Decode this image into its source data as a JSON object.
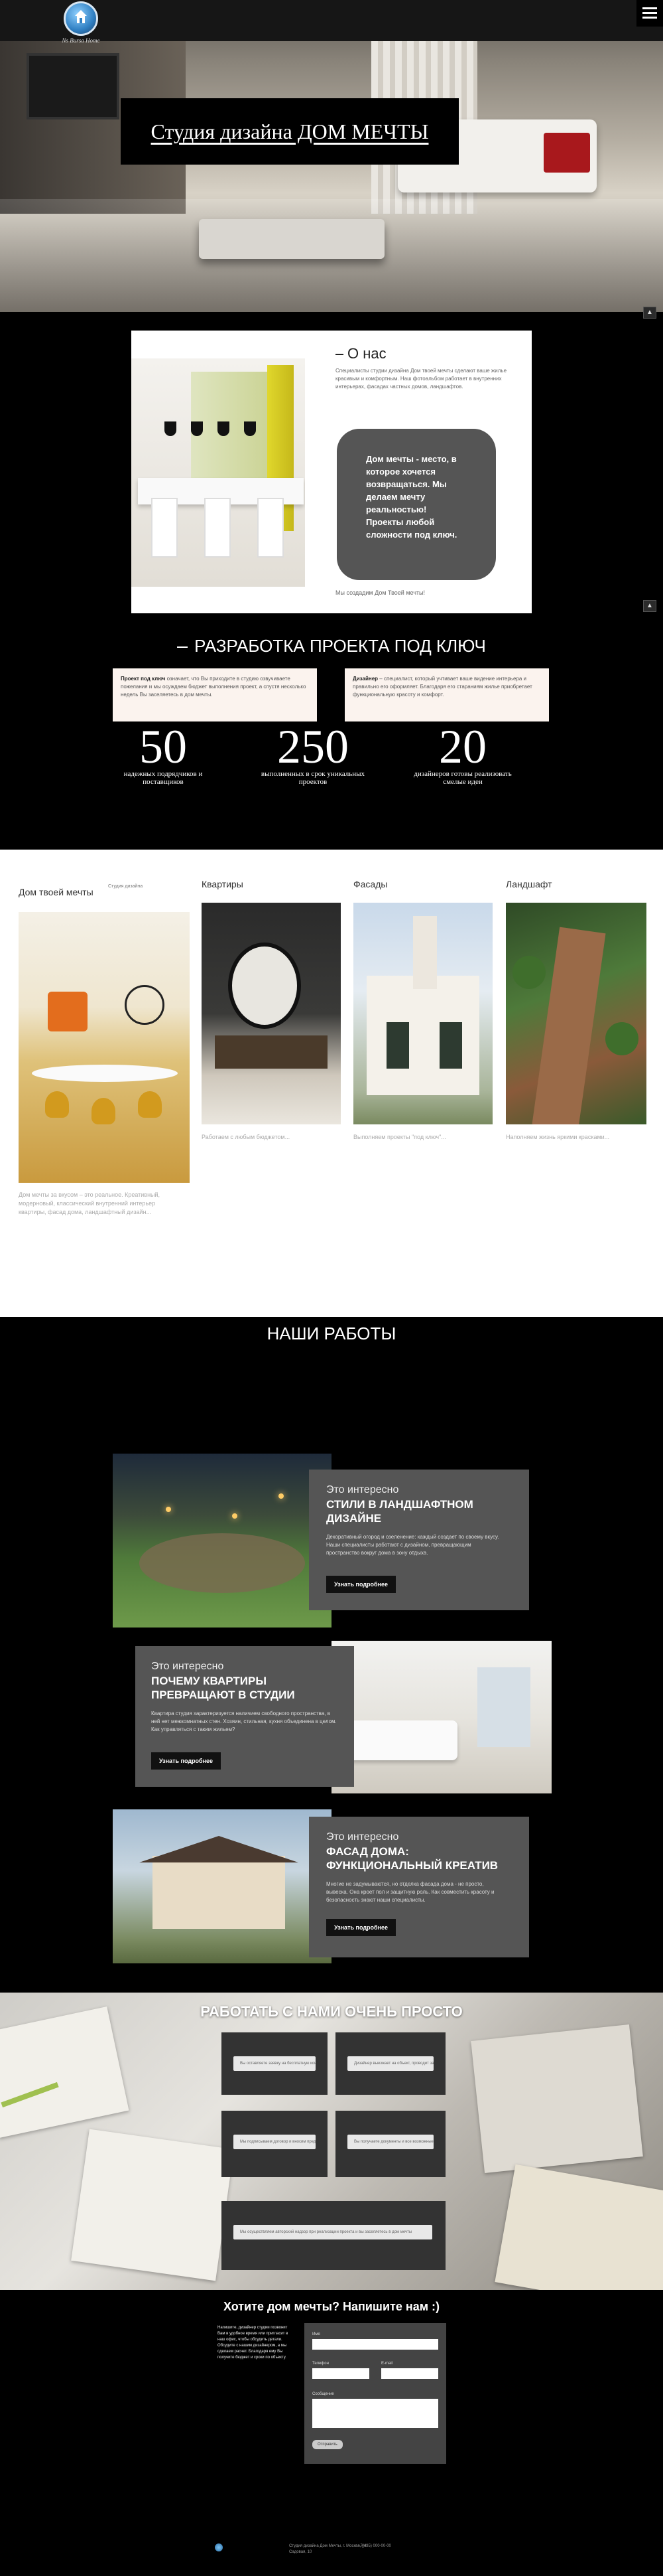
{
  "header": {
    "logo_text": "Ns Bursa Home",
    "menu_icon": "hamburger-icon"
  },
  "hero": {
    "title": "Студия дизайна ДОМ МЕЧТЫ"
  },
  "scroll_top": "▲",
  "about": {
    "title": "О нас",
    "intro": "Специалисты студии дизайна Дом твоей мечты сделают ваше жилье красивым и комфортным. Наш фотоальбом работает в внутренних интерьерах, фасадах частных домов, ландшафтов.",
    "highlight": "Дом мечты - место, в которое хочется возвращаться. Мы делаем мечту реальностью! Проекты любой сложности под ключ.",
    "signature": "Мы создадим Дом Твоей мечты!"
  },
  "turnkey": {
    "title": "РАЗРАБОТКА ПРОЕКТА ПОД КЛЮЧ",
    "box_left_label": "Проект под ключ",
    "box_left_text": "означает, что Вы приходите в студию озвучиваете пожелания и мы осуждаем бюджет выполнения проект, а спустя несколько недель Вы заселяетесь в дом мечты.",
    "box_right_label": "Дизайнер",
    "box_right_text": "– специалист, который учтивает ваше видение интерьера и правильно его оформляет. Благодаря его стараниям жилье приобретает функциональную красоту и комфорт.",
    "stats": [
      {
        "num": "50",
        "label": "надежных подрядчиков и поставщиков"
      },
      {
        "num": "250",
        "label": "выполненных в срок уникальных проектов"
      },
      {
        "num": "20",
        "label": "дизайнеров готовы реализовать смелые идеи"
      }
    ]
  },
  "services": {
    "items": [
      {
        "title": "Дом твоей мечты",
        "small": "Студия дизайна",
        "caption": "Дом мечты за вкусом – это реальное. Креативный, модерновый, классический внутренний интерьер квартиры, фасад дома, ландшафтный дизайн..."
      },
      {
        "title": "Квартиры",
        "caption": "Работаем с любым бюджетом..."
      },
      {
        "title": "Фасады",
        "caption": "Выполняем проекты \"под ключ\"..."
      },
      {
        "title": "Ландшафт",
        "caption": "Наполняем жизнь яркими красками..."
      }
    ]
  },
  "works": {
    "title": "НАШИ РАБОТЫ",
    "cards": [
      {
        "pre": "Это интересно",
        "head": "СТИЛИ В ЛАНДШАФТНОМ ДИЗАЙНЕ",
        "text": "Декоративный огород и озеленение: каждый создает по своему вкусу. Наши специалисты работают с дизайном, превращающим пространство вокруг дома в зону отдыха.",
        "button": "Узнать подробнее"
      },
      {
        "pre": "Это интересно",
        "head": "ПОЧЕМУ КВАРТИРЫ ПРЕВРАЩАЮТ В СТУДИИ",
        "text": "Квартира студия характеризуется наличием свободного пространства, в ней нет межкомнатных стен. Хозяин, стильная, кухня объединена в целом. Как управляться с таким жильем?",
        "button": "Узнать подробнее"
      },
      {
        "pre": "Это интересно",
        "head": "ФАСАД ДОМА: ФУНКЦИОНАЛЬНЫЙ КРЕАТИВ",
        "text": "Многие не задумываются, но отделка фасада дома - не просто, вывеска. Она кроет пол и защитную роль. Как совместить красоту и безопасность знают наши специалисты.",
        "button": "Узнать подробнее"
      }
    ]
  },
  "work_with_us": {
    "title": "РАБОТАТЬ С НАМИ ОЧЕНЬ ПРОСТО",
    "steps": [
      "Вы оставляете заявку на бесплатную консультацию дизайнера",
      "Дизайнер выезжает на объект, проводит замеры, обсуждает с вами проект",
      "Мы подписываем договор и вносим предоплату, начинаются работы",
      "Вы получаете документы и все возможные детали в строительстве",
      "Мы осуществляем авторский надзор при реализации проекта и вы заселяетесь в дом мечты"
    ]
  },
  "contact": {
    "title": "Хотите дом мечты? Напишите нам :)",
    "text": "Напишите, дизайнер студии позвонит Вам в удобное время или пригласит в наш офис, чтобы обсудить детали. Обсудите с нашим дизайнером, а мы сделаем расчет. Благодаря ему Вы получите бюджет и сроки по объекту.",
    "field_name": "Имя",
    "field_phone": "Телефон",
    "field_email": "E-mail",
    "field_message": "Сообщение",
    "send_button": "Отправить"
  },
  "footer": {
    "info": "Студия дизайна Дом Мечты, г. Москва, ул. Садовая, 10",
    "phone": "+7(495) 000-00-00"
  }
}
